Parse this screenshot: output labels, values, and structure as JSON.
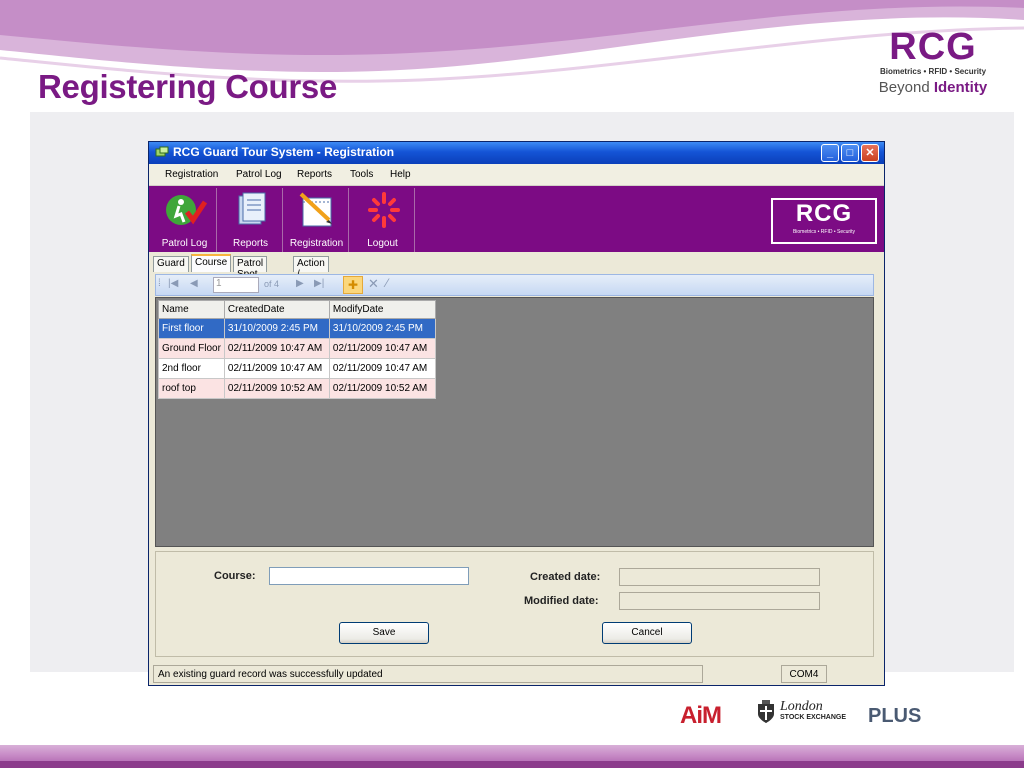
{
  "slide": {
    "title": "Registering Course",
    "brand": {
      "name": "RCG",
      "subtitle": "Biometrics • RFID • Security",
      "tagline_1": "Beyond",
      "tagline_2": "Identity"
    },
    "partners": {
      "aim": "AiM",
      "lse_line1": "London",
      "lse_line2": "STOCK EXCHANGE",
      "plus": "PLUS"
    }
  },
  "window": {
    "title": "RCG Guard Tour System - Registration",
    "controls": {
      "minimize": "_",
      "maximize": "□",
      "close": "✕"
    },
    "menu": [
      "Registration",
      "Patrol Log",
      "Reports",
      "Tools",
      "Help"
    ],
    "toolbar": [
      {
        "label": "Patrol Log",
        "icon": "patrol-log-icon"
      },
      {
        "label": "Reports",
        "icon": "reports-icon"
      },
      {
        "label": "Registration",
        "icon": "registration-icon"
      },
      {
        "label": "Logout",
        "icon": "logout-icon"
      }
    ],
    "banner_logo": {
      "name": "RCG",
      "subtitle": "Biometrics • RFID • Security"
    },
    "tabs": [
      "Guard",
      "Course",
      "Patrol Spot",
      "Action / Event"
    ],
    "active_tab": "Course",
    "navigator": {
      "position": "1",
      "of": "of 4"
    },
    "grid": {
      "columns": [
        "Name",
        "CreatedDate",
        "ModifyDate"
      ],
      "rows": [
        [
          "First floor",
          "31/10/2009 2:45 PM",
          "31/10/2009 2:45 PM"
        ],
        [
          "Ground Floor",
          "02/11/2009 10:47 AM",
          "02/11/2009 10:47 AM"
        ],
        [
          "2nd floor",
          "02/11/2009 10:47 AM",
          "02/11/2009 10:47 AM"
        ],
        [
          "roof top",
          "02/11/2009 10:52 AM",
          "02/11/2009 10:52 AM"
        ]
      ]
    },
    "form": {
      "course_label": "Course:",
      "course_value": "",
      "created_label": "Created date:",
      "created_value": "",
      "modified_label": "Modified date:",
      "modified_value": "",
      "save": "Save",
      "cancel": "Cancel"
    },
    "status": {
      "message": "An existing guard record was successfully updated",
      "port": "COM4"
    }
  },
  "colors": {
    "brand_purple": "#7a1a84",
    "banner_purple": "#7c0b84",
    "selection": "#316ac5",
    "alt_row": "#fbe3e3"
  }
}
